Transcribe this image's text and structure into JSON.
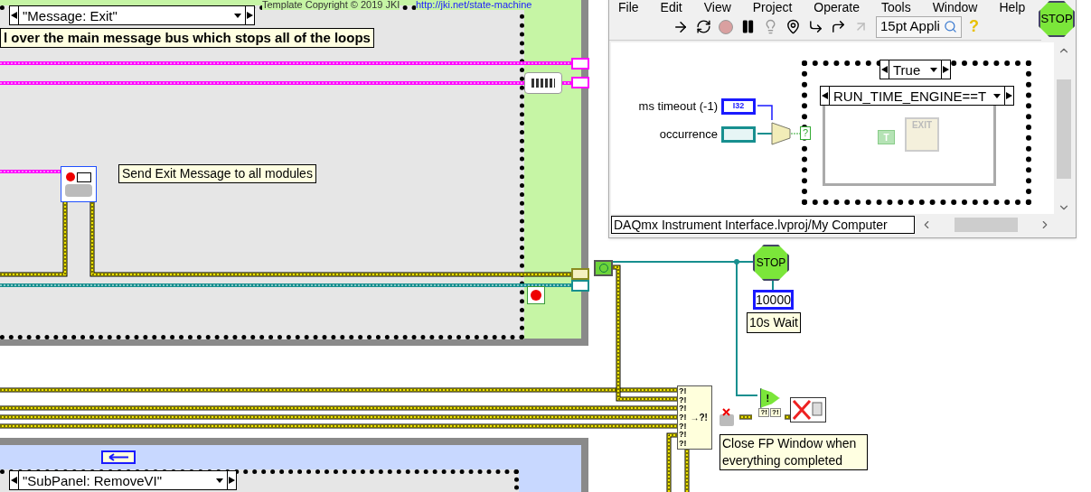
{
  "diagram": {
    "header_text": "Template Copyright © 2019 JKI",
    "header_link": "http://jki.net/state-machine",
    "case_selector": "\"Message: Exit\"",
    "comment_top": "l over the main message bus which stops all of the loops",
    "comment_send": "Send Exit Message to all modules",
    "stop_sign": "STOP",
    "stop_constant": "10000",
    "stop_label": "10s Wait",
    "build_array_inputs": [
      "?!",
      "?!",
      "?!",
      "?!",
      "?!",
      "?!",
      "?!"
    ],
    "build_array_output": "→?!",
    "select_mark": "!",
    "select_inputs": [
      "?!",
      "?!"
    ],
    "comment_close": "Close FP Window when everything completed",
    "bottom_case_selector": "\"SubPanel: RemoveVI\""
  },
  "window": {
    "menu": [
      "File",
      "Edit",
      "View",
      "Project",
      "Operate",
      "Tools",
      "Window",
      "Help"
    ],
    "font_selector": "15pt Appli",
    "help_mark": "?",
    "stop_sign": "STOP",
    "controls": [
      {
        "label": "ms timeout (-1)",
        "kind": "i32",
        "text": "I32"
      },
      {
        "label": "occurrence",
        "kind": "occurrence"
      }
    ],
    "case_terminal": "?",
    "outer_case": "True",
    "inner_case": "RUN_TIME_ENGINE==T",
    "true_constant": "T",
    "exit_icon_text": "EXIT",
    "status_path": "DAQmx Instrument Interface.lvproj/My Computer"
  }
}
